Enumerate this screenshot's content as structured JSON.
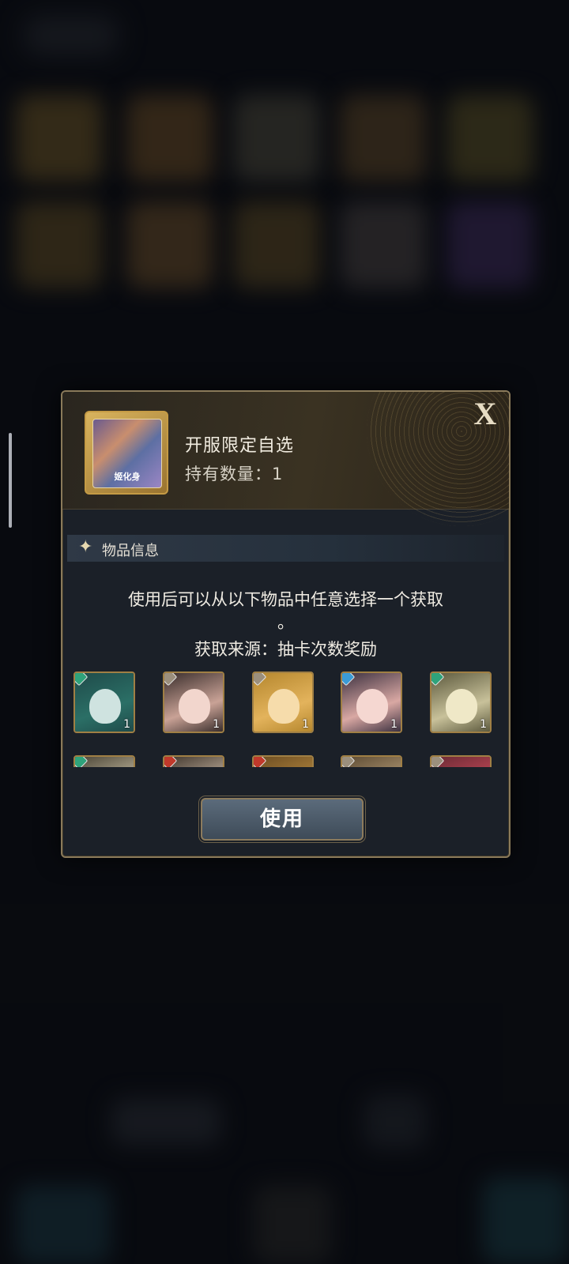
{
  "dialog": {
    "item_name": "开服限定自选",
    "quantity_label": "持有数量：1",
    "close_label": "X",
    "section_title": "物品信息",
    "description_line1": "使用后可以从以下物品中任意选择一个获取",
    "description_line2": "。",
    "source": "获取来源：抽卡次数奖励",
    "use_button_label": "使用",
    "icon_text": "姬化身"
  },
  "rewards": [
    {
      "count": "1",
      "badge_color": "#2fa37b",
      "palette": [
        "#1f4b4a",
        "#2b6f66",
        "#cfe3e0"
      ]
    },
    {
      "count": "1",
      "badge_color": "#9b8f7d",
      "palette": [
        "#3a2e2c",
        "#c9a296",
        "#f2d6cd"
      ]
    },
    {
      "count": "1",
      "badge_color": "#9b8f7d",
      "palette": [
        "#b5872e",
        "#e3b35c",
        "#f6dcab"
      ]
    },
    {
      "count": "1",
      "badge_color": "#3b9bd6",
      "palette": [
        "#3c3140",
        "#d9a8a3",
        "#f5d7d1"
      ]
    },
    {
      "count": "1",
      "badge_color": "#2fa37b",
      "palette": [
        "#5d5a3e",
        "#c8c19a",
        "#efe8c7"
      ]
    },
    {
      "count": "",
      "badge_color": "#2fa37b",
      "palette": [
        "#4a4436",
        "#c9bfa4",
        "#e9dfc4"
      ]
    },
    {
      "count": "",
      "badge_color": "#c0392b",
      "palette": [
        "#40362d",
        "#cbb9a5",
        "#e4d8c8"
      ]
    },
    {
      "count": "",
      "badge_color": "#c0392b",
      "palette": [
        "#6b4c22",
        "#b88a3f",
        "#e5c07c"
      ]
    },
    {
      "count": "",
      "badge_color": "#9b8f7d",
      "palette": [
        "#5c4a33",
        "#b79e78",
        "#e2d2b5"
      ]
    },
    {
      "count": "",
      "badge_color": "#9b8f7d",
      "palette": [
        "#6a2a35",
        "#c74a58",
        "#eab4b7"
      ]
    }
  ]
}
